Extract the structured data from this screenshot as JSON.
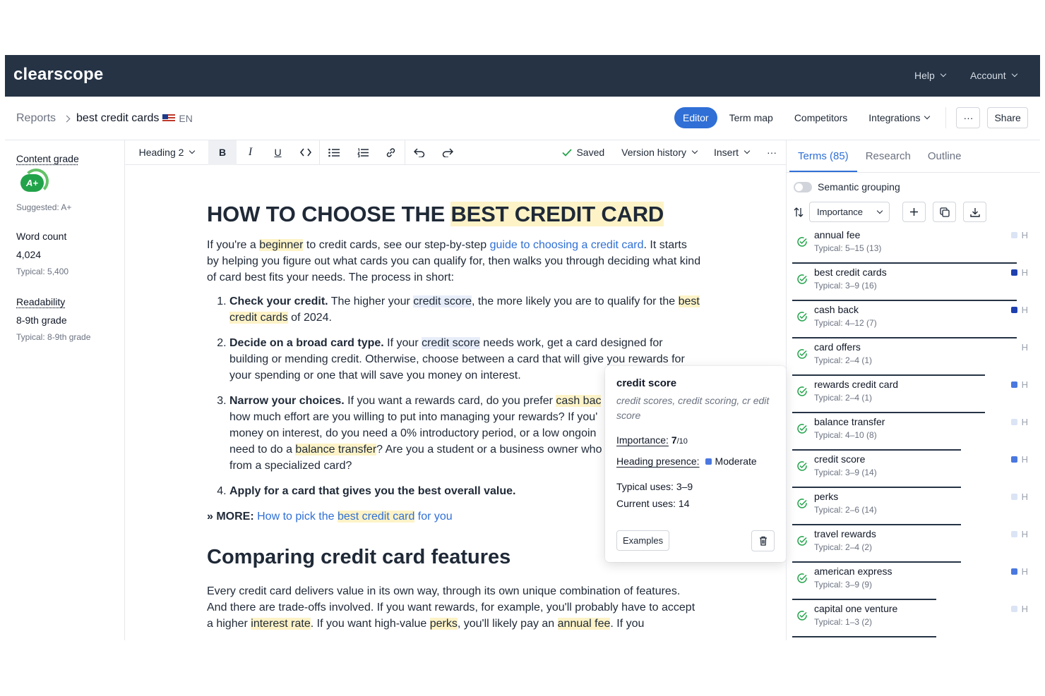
{
  "app": {
    "logo": "clearscope",
    "nav_help": "Help",
    "nav_account": "Account"
  },
  "subbar": {
    "crumb_root": "Reports",
    "crumb_current": "best credit cards",
    "lang": "EN",
    "tabs": [
      "Editor",
      "Term map",
      "Competitors",
      "Integrations"
    ],
    "more_label": "···",
    "share_label": "Share"
  },
  "metrics": {
    "grade_title": "Content grade",
    "grade": "A+",
    "suggested": "Suggested: A+",
    "wc_title": "Word count",
    "wc_value": "4,024",
    "wc_typical": "Typical: 5,400",
    "read_title": "Readability",
    "read_value": "8-9th grade",
    "read_typical": "Typical: 8-9th grade"
  },
  "toolbar": {
    "style": "Heading 2",
    "saved": "Saved",
    "version_history": "Version history",
    "insert": "Insert",
    "more": "···"
  },
  "doc": {
    "h1_a": "HOW TO CHOOSE THE ",
    "h1_b": "BEST CREDIT CARD",
    "p1_a": "If you're a ",
    "p1_b": "beginner",
    "p1_c": " to credit cards, see our step-by-step ",
    "p1_link": "guide to choosing a credit card",
    "p1_d": ". It starts by helping you figure out what cards you can qualify for, then walks you through deciding what kind of card best fits your needs. The process in short:",
    "s1_bold": "Check your credit.",
    "s1_a": " The higher your ",
    "s1_hl": "credit score",
    "s1_b": ", the more likely you are to qualify for the ",
    "s1_hl2": "best credit cards",
    "s1_c": " of 2024.",
    "s2_bold": "Decide on a broad card type.",
    "s2_a": " If your ",
    "s2_hl": "credit score",
    "s2_b": " needs work, get a card designed for building or mending credit. Otherwise, choose between a card that will give you rewards for your spending or one that will save you money on interest.",
    "s3_bold": "Narrow your choices.",
    "s3_a": " If you want a rewards card, do you prefer ",
    "s3_hl": "cash bac",
    "s3_b": " how much effort are you willing to put into managing your rewards? If you'",
    "s3_c": " money on interest, do you need a 0% introductory period, or a low ongoin",
    "s3_d": " need to do a ",
    "s3_hl2": "balance transfer",
    "s3_e": "? Are you a student or a business owner who",
    "s3_f": " from a specialized card?",
    "s4_bold": "Apply for a card that gives you the best overall value.",
    "more_bold": "» MORE:",
    "more_link_a": " How to pick the ",
    "more_link_hl": "best credit card",
    "more_link_b": " for you",
    "h2": "Comparing credit card features",
    "p2_a": "Every credit card delivers value in its own way, through its own unique combination of features. And there are trade-offs involved. If you want rewards, for example, you'll probably have to accept a higher ",
    "p2_hl1": "interest rate",
    "p2_b": ". If you want high-value ",
    "p2_hl2": "perks",
    "p2_c": ", you'll likely pay an ",
    "p2_hl3": "annual fee",
    "p2_d": ". If you"
  },
  "popover": {
    "title": "credit score",
    "variants": "credit scores, credit scoring, cr edit score",
    "importance_label": "Importance:",
    "importance_value": "7",
    "importance_max": "/10",
    "heading_label": "Heading presence:",
    "heading_value": "Moderate",
    "typical_uses": "Typical uses: 3–9",
    "current_uses": "Current uses: 14",
    "examples_label": "Examples"
  },
  "panel": {
    "tabs": [
      "Terms (85)",
      "Research",
      "Outline"
    ],
    "toggle_label": "Semantic grouping",
    "sort_label": "Importance",
    "heading_marker": "H",
    "terms": [
      {
        "name": "annual fee",
        "typical": "Typical: 5–15 (13)",
        "marker": "#dbe4f5",
        "fill": 0.92
      },
      {
        "name": "best credit cards",
        "typical": "Typical: 3–9 (16)",
        "marker": "#1e40af",
        "fill": 0.92
      },
      {
        "name": "cash back",
        "typical": "Typical: 4–12 (7)",
        "marker": "#1e40af",
        "fill": 0.92
      },
      {
        "name": "card offers",
        "typical": "Typical: 2–4 (1)",
        "marker": "",
        "fill": 0.79
      },
      {
        "name": "rewards credit card",
        "typical": "Typical: 2–4 (1)",
        "marker": "#4a78e0",
        "fill": 0.79
      },
      {
        "name": "balance transfer",
        "typical": "Typical: 4–10 (8)",
        "marker": "#dbe4f5",
        "fill": 0.69
      },
      {
        "name": "credit score",
        "typical": "Typical: 3–9 (14)",
        "marker": "#4a78e0",
        "fill": 0.69
      },
      {
        "name": "perks",
        "typical": "Typical: 2–6 (14)",
        "marker": "#dbe4f5",
        "fill": 0.69
      },
      {
        "name": "travel rewards",
        "typical": "Typical: 2–4 (2)",
        "marker": "#dbe4f5",
        "fill": 0.69
      },
      {
        "name": "american express",
        "typical": "Typical: 3–9 (9)",
        "marker": "#4a78e0",
        "fill": 0.59
      },
      {
        "name": "capital one venture",
        "typical": "Typical: 1–3 (2)",
        "marker": "#dbe4f5",
        "fill": 0.59
      }
    ]
  },
  "colors": {
    "accent": "#2f6fd6",
    "topbar": "#253345",
    "grade_green": "#22a34a",
    "highlight": "#fdf3c7",
    "check_green": "#22a34a"
  }
}
